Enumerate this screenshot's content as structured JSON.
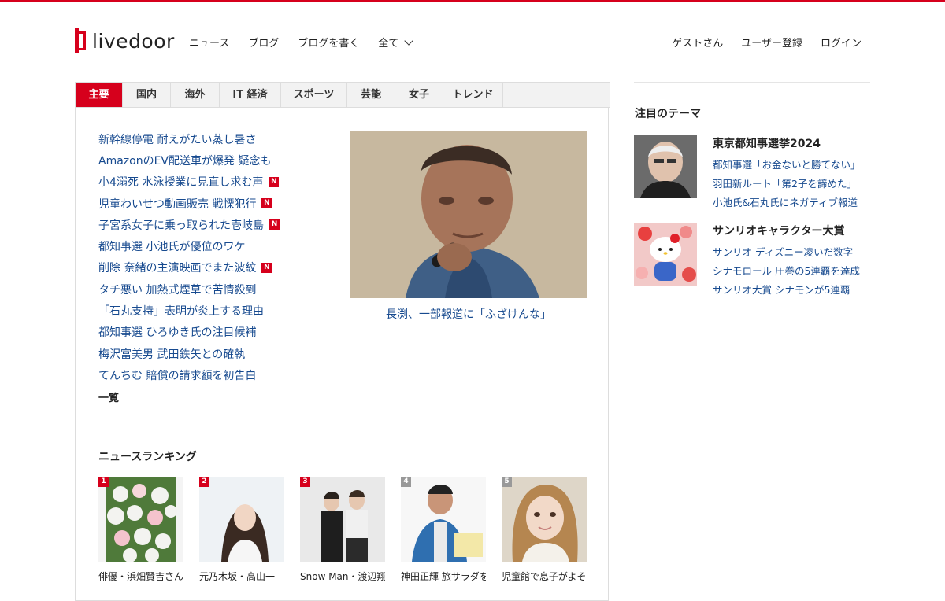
{
  "site": {
    "logo_text": "livedoor",
    "brand_color": "#d6001c",
    "link_color": "#174a8f"
  },
  "global_nav": {
    "news": "ニュース",
    "blog": "ブログ",
    "write_blog": "ブログを書く",
    "all": "全て"
  },
  "user_nav": {
    "guest": "ゲストさん",
    "register": "ユーザー登録",
    "login": "ログイン"
  },
  "tabs": [
    "主要",
    "国内",
    "海外",
    "IT 経済",
    "スポーツ",
    "芸能",
    "女子",
    "トレンド"
  ],
  "headlines": [
    {
      "text": "新幹線停電 耐えがたい蒸し暑さ",
      "new": false
    },
    {
      "text": "AmazonのEV配送車が爆発 疑念も",
      "new": false
    },
    {
      "text": "小4溺死 水泳授業に見直し求む声",
      "new": true
    },
    {
      "text": "児童わいせつ動画販売 戦慄犯行",
      "new": true
    },
    {
      "text": "子宮系女子に乗っ取られた壱岐島",
      "new": true
    },
    {
      "text": "都知事選 小池氏が優位のワケ",
      "new": false
    },
    {
      "text": "削除 奈緒の主演映画でまた波紋",
      "new": true
    },
    {
      "text": "タチ悪い 加熱式煙草で苦情殺到",
      "new": false
    },
    {
      "text": "「石丸支持」表明が炎上する理由",
      "new": false
    },
    {
      "text": "都知事選 ひろゆき氏の注目候補",
      "new": false
    },
    {
      "text": "梅沢富美男 武田鉄矢との確執",
      "new": false
    },
    {
      "text": "てんちむ 賠償の請求額を初告白",
      "new": false
    }
  ],
  "new_badge": "N",
  "more_label": "一覧",
  "top_story": {
    "caption": "長渕、一部報道に「ふざけんな」"
  },
  "ranking": {
    "title": "ニュースランキング",
    "items": [
      {
        "rank": "1",
        "caption": "俳優・浜畑賢吉さん、"
      },
      {
        "rank": "2",
        "caption": "元乃木坂・高山一"
      },
      {
        "rank": "3",
        "caption": "Snow Man・渡辺翔"
      },
      {
        "rank": "4",
        "caption": "神田正輝 旅サラダを"
      },
      {
        "rank": "5",
        "caption": "児童館で息子がよそ"
      }
    ]
  },
  "sidebar": {
    "title": "注目のテーマ",
    "themes": [
      {
        "title": "東京都知事選挙2024",
        "links": [
          "都知事選「お金ないと勝てない」",
          "羽田新ルート「第2子を諦めた」",
          "小池氏&石丸氏にネガティブ報道"
        ]
      },
      {
        "title": "サンリオキャラクター大賞",
        "links": [
          "サンリオ ディズニー凌いだ数字",
          "シナモロール 圧巻の5連覇を達成",
          "サンリオ大賞 シナモンが5連覇"
        ]
      }
    ]
  }
}
